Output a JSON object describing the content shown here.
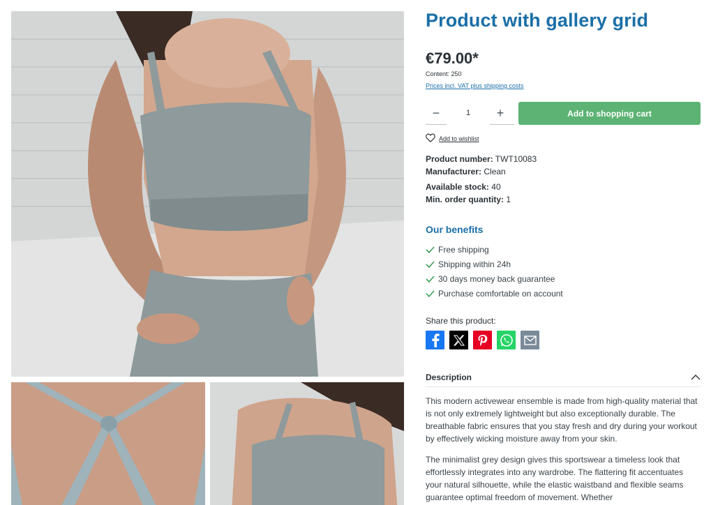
{
  "product": {
    "title": "Product with gallery grid",
    "price": "€79.00*",
    "content": "Content: 250",
    "tax_note": "Prices incl. VAT plus shipping costs"
  },
  "buy": {
    "quantity": "1",
    "minus": "−",
    "plus": "+",
    "cart_label": "Add to shopping cart",
    "wishlist_label": "Add to wishlist"
  },
  "props": [
    {
      "label": "Product number:",
      "value": "TWT10083"
    },
    {
      "label": "Manufacturer:",
      "value": "Clean"
    },
    {
      "label": "Available stock:",
      "value": "40"
    },
    {
      "label": "Min. order quantity:",
      "value": "1"
    }
  ],
  "benefits": {
    "title": "Our benefits",
    "items": [
      "Free shipping",
      "Shipping within 24h",
      "30 days money back guarantee",
      "Purchase comfortable on account"
    ]
  },
  "share": {
    "label": "Share this product:",
    "icons": [
      "facebook-icon",
      "x-icon",
      "pinterest-icon",
      "whatsapp-icon",
      "mail-icon"
    ]
  },
  "description": {
    "header": "Description",
    "p1": "This modern activewear ensemble is made from high-quality material that is not only extremely lightweight but also exceptionally durable. The breathable fabric ensures that you stay fresh and dry during your workout by effectively wicking moisture away from your skin.",
    "p2": "The minimalist grey design gives this sportswear a timeless look that effortlessly integrates into any wardrobe. The flattering fit accentuates your natural silhouette, while the elastic waistband and flexible seams guarantee optimal freedom of movement. Whether"
  },
  "colors": {
    "title": "#1a6fa8",
    "cart": "#5cb374",
    "check": "#3fa15a"
  }
}
